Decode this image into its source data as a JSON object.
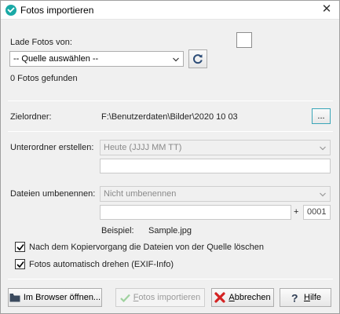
{
  "window": {
    "title": "Fotos importieren",
    "accent": "#1aa9a6"
  },
  "source": {
    "label": "Lade Fotos von:",
    "select_value": "-- Quelle auswählen --",
    "found_text": "0 Fotos gefunden"
  },
  "target": {
    "label": "Zielordner:",
    "path": "F:\\Benutzerdaten\\Bilder\\2020 10 03",
    "browse_label": "..."
  },
  "subfolder": {
    "label": "Unterordner erstellen:",
    "select_value": "Heute (JJJJ MM TT)",
    "text_value": ""
  },
  "rename": {
    "label": "Dateien umbenennen:",
    "select_value": "Nicht umbenennen",
    "text_value": "",
    "plus": "+",
    "counter": "0001",
    "example_label": "Beispiel:",
    "example_value": "Sample.jpg"
  },
  "options": {
    "delete_after_copy": {
      "label": "Nach dem Kopiervorgang die Dateien von der Quelle löschen",
      "checked": true
    },
    "auto_rotate": {
      "label": "Fotos automatisch drehen (EXIF-Info)",
      "checked": true
    }
  },
  "buttons": {
    "browser": {
      "label": "Im Browser öffnen...",
      "icon": "folder-icon"
    },
    "import": {
      "label": "Fotos importieren",
      "icon": "checkmark-icon",
      "accesskey": "F",
      "rest": "otos importieren"
    },
    "cancel": {
      "label": "Abbrechen",
      "icon": "red-x-icon",
      "accesskey": "A",
      "rest": "bbrechen"
    },
    "help": {
      "label": "Hilfe",
      "icon": "question-icon",
      "accesskey": "H",
      "rest": "ilfe"
    }
  }
}
